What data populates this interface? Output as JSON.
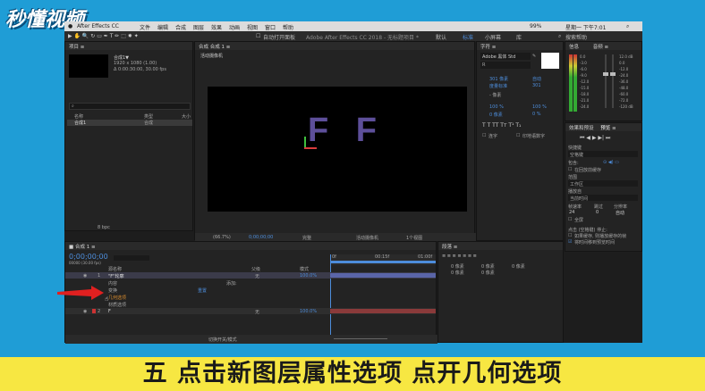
{
  "watermark": {
    "logo_text": "秒懂视频"
  },
  "window_title": "Adobe After Effects CC 2018 - 无标题项目 *",
  "menu": [
    "After Effects CC",
    "文件",
    "编辑",
    "合成",
    "图层",
    "效果",
    "动画",
    "视图",
    "窗口",
    "帮助"
  ],
  "status": {
    "battery": "99%",
    "clock": "星期一 下午7:01"
  },
  "toolbar": {
    "snap_label": "自动打开面板",
    "workspaces": [
      "默认",
      "标准",
      "小屏幕",
      "库"
    ],
    "search_placeholder": "搜索帮助"
  },
  "project_panel": {
    "tab": "项目",
    "comp_name": "合成1▼",
    "comp_info1": "1920 x 1080 (1.00)",
    "comp_info2": "Δ 0:00:30:00, 30.00 fps",
    "col_name": "名称",
    "col_type": "类型",
    "col_size": "大小",
    "item_name": "合成1",
    "item_type": "合成",
    "bpc": "8 bpc"
  },
  "viewer": {
    "tab": "合成 合成 1",
    "camera_label": "活动摄像机",
    "text_content": "F F",
    "zoom": "(66.7%)",
    "timecode": "0;00;00;00",
    "quality": "完整",
    "view_camera": "活动摄像机",
    "view_count": "1个视图"
  },
  "char_panel": {
    "tab": "字符",
    "font": "Adobe 黑体 Std",
    "style": "R",
    "size": "301 像素",
    "leading": "自动",
    "kerning": "度量标准",
    "tracking": "301",
    "stroke": "- 像素",
    "vscale": "100 %",
    "hscale": "100 %",
    "baseline": "0 像素",
    "tsume": "0 %",
    "ligature": "连字",
    "hindi": "印地语数字"
  },
  "info_panel": {
    "tab_info": "信息",
    "tab_audio": "音频",
    "levels": [
      "0.0",
      "-3.0",
      "-6.0",
      "-9.0",
      "-12.0",
      "-15.0",
      "-18.0",
      "-21.0",
      "-24.0"
    ],
    "db_right": [
      "12.0 dB",
      "0.0",
      "-12.0",
      "-24.0",
      "-36.0",
      "-48.0",
      "-60.0",
      "-72.0",
      "-120 dB"
    ]
  },
  "preview_panel": {
    "tab_fx": "效果和预设",
    "tab_preview": "预览",
    "shortcut_label": "快捷键",
    "shortcut_value": "空格键",
    "include_label": "包含:",
    "cache_label": "在回放前缓存",
    "range_label": "范围",
    "range_value": "工作区",
    "play_from_label": "播放自",
    "play_from_value": "当前时间",
    "fps_label": "帧速率",
    "skip_label": "跳过",
    "res_label": "分辨率",
    "fps_value": "24",
    "skip_value": "0",
    "res_value": "自动",
    "fullscreen_label": "全屏",
    "stop_label": "点击 (空格键) 停止:",
    "stop_opt1": "如果缓存, 则播放缓存的帧",
    "stop_opt2": "将时间移到预览时间"
  },
  "timeline": {
    "tab": "合成 1",
    "timecode": "0;00;00;00",
    "timecode_sub": "00000 (30.00 fps)",
    "col_source": "源名称",
    "col_parent": "父级",
    "col_mode": "模式",
    "layers": [
      {
        "num": "1",
        "name": "\"F\"轮廓",
        "parent": "无",
        "value": "100.0%"
      },
      {
        "num": "2",
        "name": "F",
        "parent": "无",
        "value": "100.0%"
      }
    ],
    "sub_items": [
      "内容",
      "变换",
      "几何选项",
      "材质选项"
    ],
    "add_label": "添加:",
    "reset_label": "重置",
    "bottom_label": "切换开关/模式",
    "ruler": [
      "0f",
      "00:15f",
      "01:00f"
    ]
  },
  "paragraph_panel": {
    "tab": "段落",
    "fields": [
      "0 像素",
      "0 像素",
      "0 像素",
      "0 像素",
      "0 像素"
    ]
  },
  "caption": "五 点击新图层属性选项 点开几何选项"
}
